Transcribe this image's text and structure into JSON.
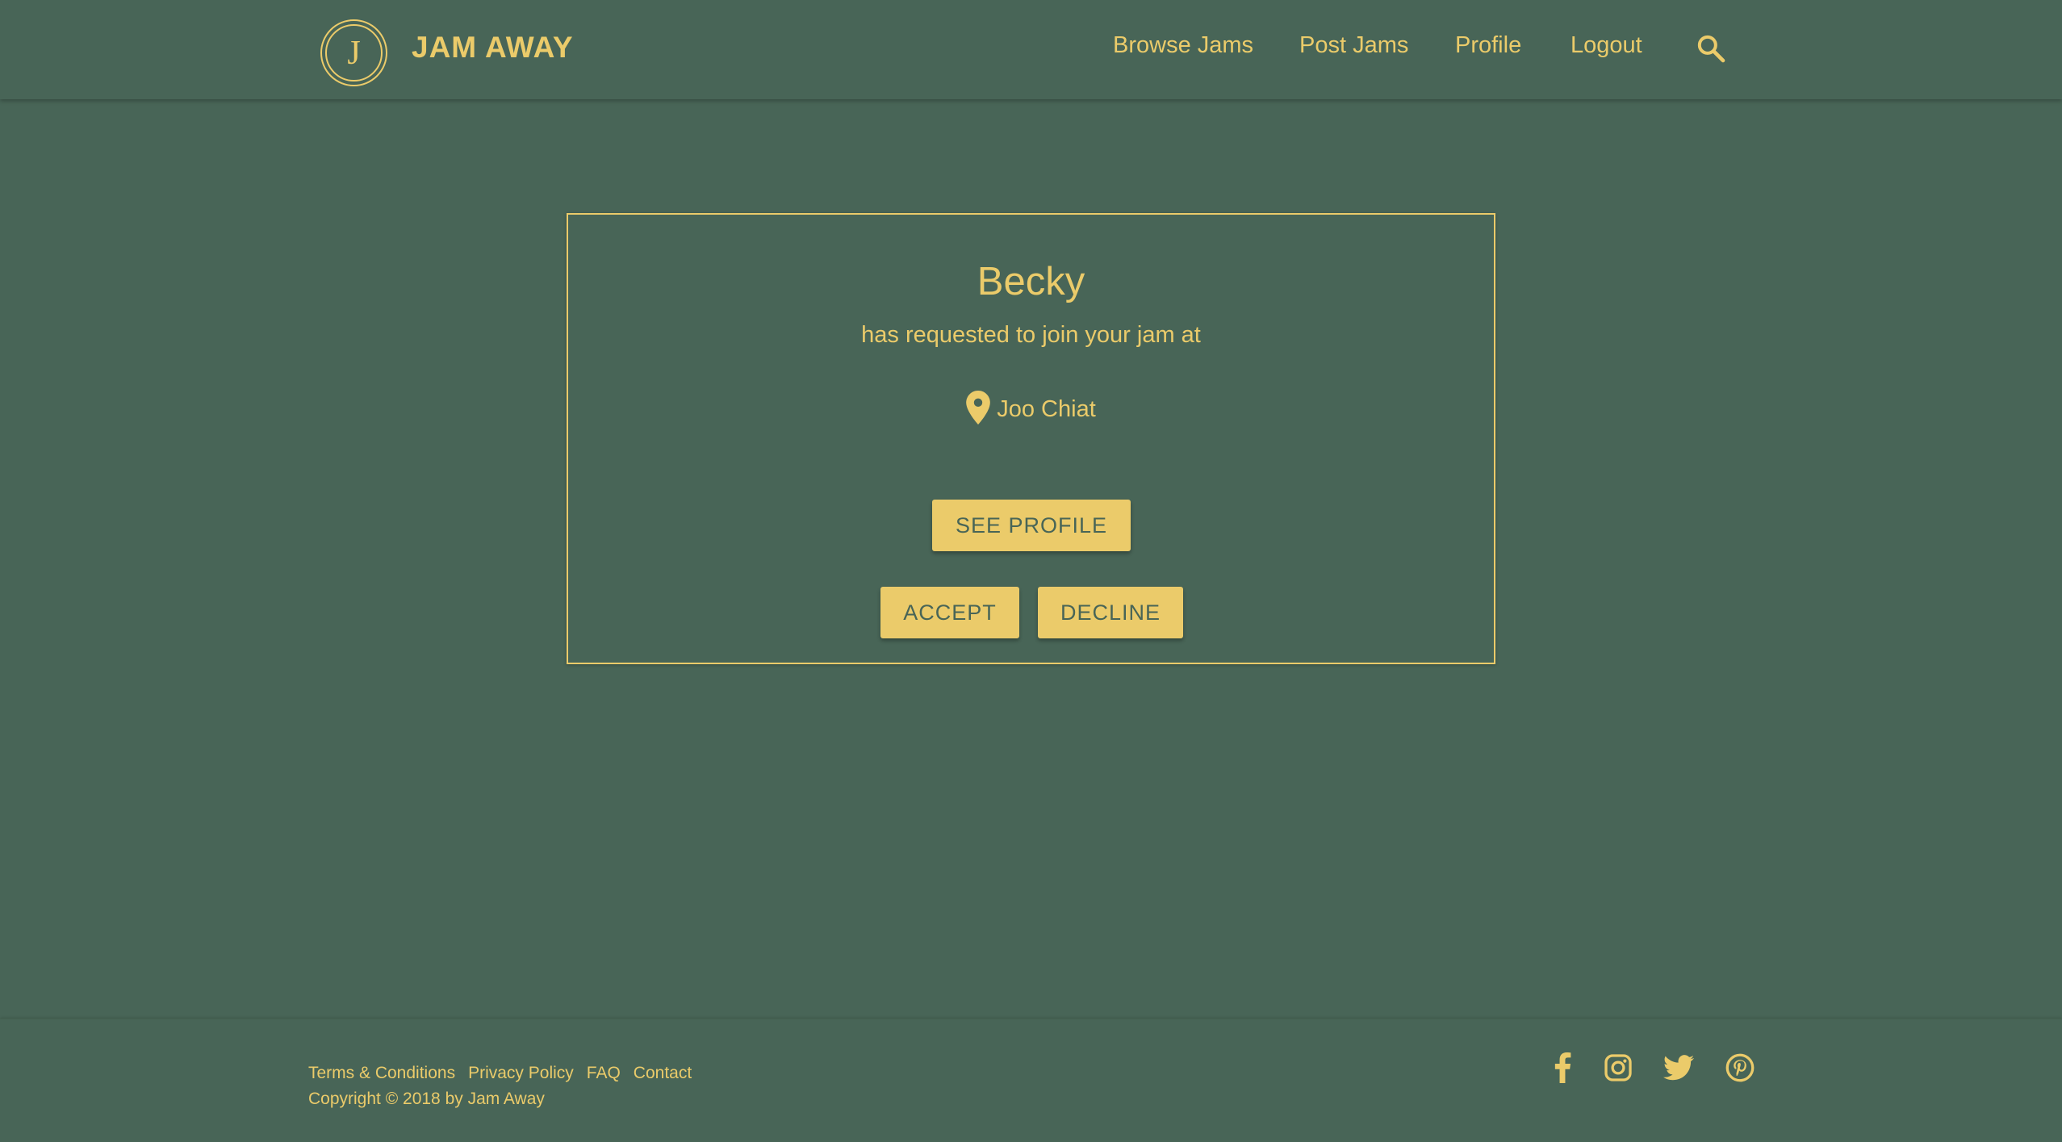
{
  "brand": {
    "logo_letter": "J",
    "name": "JAM AWAY",
    "color": "#ebcb6a",
    "background": "#486557"
  },
  "nav": {
    "items": [
      {
        "label": "Browse Jams"
      },
      {
        "label": "Post Jams"
      },
      {
        "label": "Profile"
      },
      {
        "label": "Logout"
      }
    ],
    "search_icon": "search-icon"
  },
  "request_card": {
    "requester": "Becky",
    "message": "has requested to join your jam at",
    "location_icon": "map-pin-icon",
    "location": "Joo Chiat",
    "see_profile_label": "SEE PROFILE",
    "accept_label": "ACCEPT",
    "decline_label": "DECLINE"
  },
  "footer": {
    "links": [
      {
        "label": "Terms & Conditions"
      },
      {
        "label": "Privacy Policy"
      },
      {
        "label": "FAQ"
      },
      {
        "label": "Contact"
      }
    ],
    "copyright": "Copyright © 2018 by Jam Away",
    "social_icons": [
      "facebook-icon",
      "instagram-icon",
      "twitter-icon",
      "pinterest-icon"
    ]
  }
}
